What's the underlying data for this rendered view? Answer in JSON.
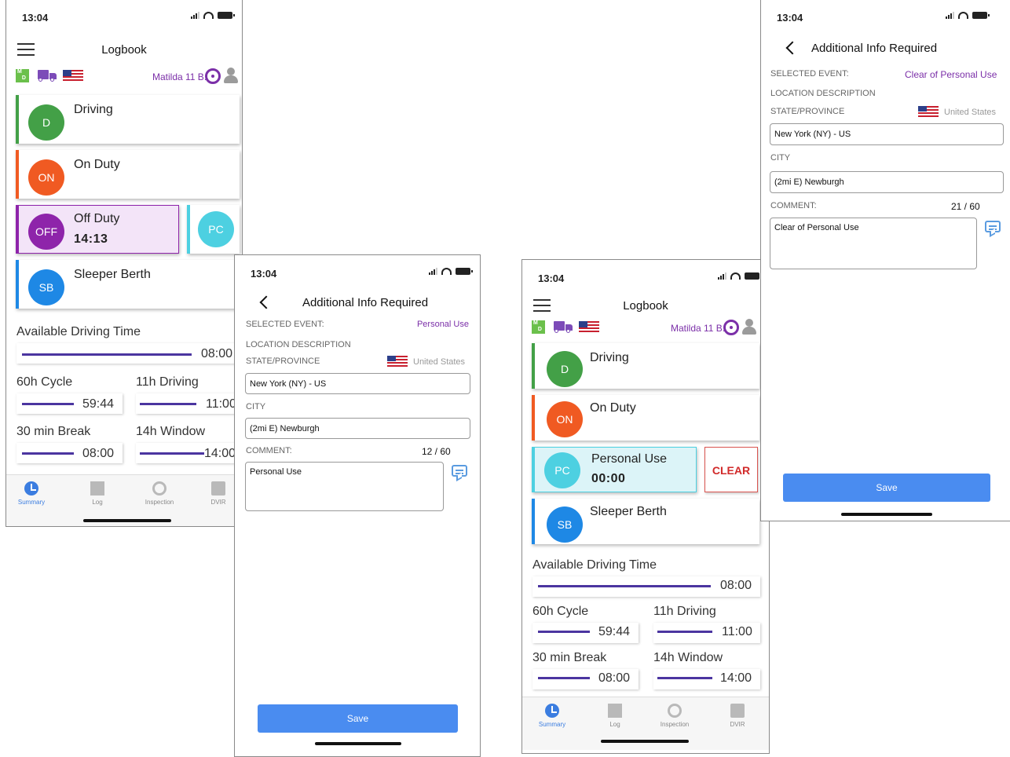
{
  "status": {
    "time": "13:04"
  },
  "logbook": {
    "title": "Logbook",
    "md_badge_top": "M",
    "md_badge_bottom": "D",
    "user_name": "Matilda 11 B.",
    "tabs": [
      "Summary",
      "Log",
      "Inspection",
      "DVIR"
    ]
  },
  "screen1": {
    "statuses": [
      {
        "code": "D",
        "label": "Driving"
      },
      {
        "code": "ON",
        "label": "On Duty"
      },
      {
        "code": "OFF",
        "label": "Off Duty",
        "time": "14:13"
      },
      {
        "code": "SB",
        "label": "Sleeper Berth"
      }
    ],
    "pc_code": "PC",
    "available_label": "Available Driving Time",
    "available_value": "08:00",
    "cycle_label": "60h Cycle",
    "cycle_value": "59:44",
    "driving11_label": "11h Driving",
    "driving11_value": "11:00",
    "break_label": "30 min Break",
    "break_value": "08:00",
    "window_label": "14h Window",
    "window_value": "14:00"
  },
  "screen2": {
    "title": "Additional Info Required",
    "selected_event_label": "SELECTED EVENT:",
    "selected_event_value": "Personal Use",
    "location_label": "LOCATION DESCRIPTION",
    "state_label": "STATE/PROVINCE",
    "country": "United States",
    "state_value": "New York (NY) - US",
    "city_label": "CITY",
    "city_value": "(2mi E) Newburgh",
    "comment_label": "COMMENT:",
    "comment_counter": "12 / 60",
    "comment_value": "Personal Use",
    "save_label": "Save"
  },
  "screen3": {
    "statuses": [
      {
        "code": "D",
        "label": "Driving"
      },
      {
        "code": "ON",
        "label": "On Duty"
      },
      {
        "code": "PC",
        "label": "Personal Use",
        "time": "00:00"
      },
      {
        "code": "SB",
        "label": "Sleeper Berth"
      }
    ],
    "clear_label": "CLEAR",
    "available_label": "Available Driving Time",
    "available_value": "08:00",
    "cycle_label": "60h Cycle",
    "cycle_value": "59:44",
    "driving11_label": "11h Driving",
    "driving11_value": "11:00",
    "break_label": "30 min Break",
    "break_value": "08:00",
    "window_label": "14h Window",
    "window_value": "14:00"
  },
  "screen4": {
    "title": "Additional Info Required",
    "selected_event_label": "SELECTED EVENT:",
    "selected_event_value": "Clear of Personal Use",
    "location_label": "LOCATION DESCRIPTION",
    "state_label": "STATE/PROVINCE",
    "country": "United States",
    "state_value": "New York (NY) - US",
    "city_label": "CITY",
    "city_value": "(2mi E) Newburgh",
    "comment_label": "COMMENT:",
    "comment_counter": "21 / 60",
    "comment_value": "Clear of Personal Use",
    "save_label": "Save"
  },
  "colors": {
    "driving": "#43a047",
    "on_duty": "#f05a22",
    "off_duty": "#8e24aa",
    "sleeper": "#1e88e5",
    "personal": "#4dd0e1",
    "accent": "#7b2fa8",
    "save": "#4a8cf0"
  }
}
